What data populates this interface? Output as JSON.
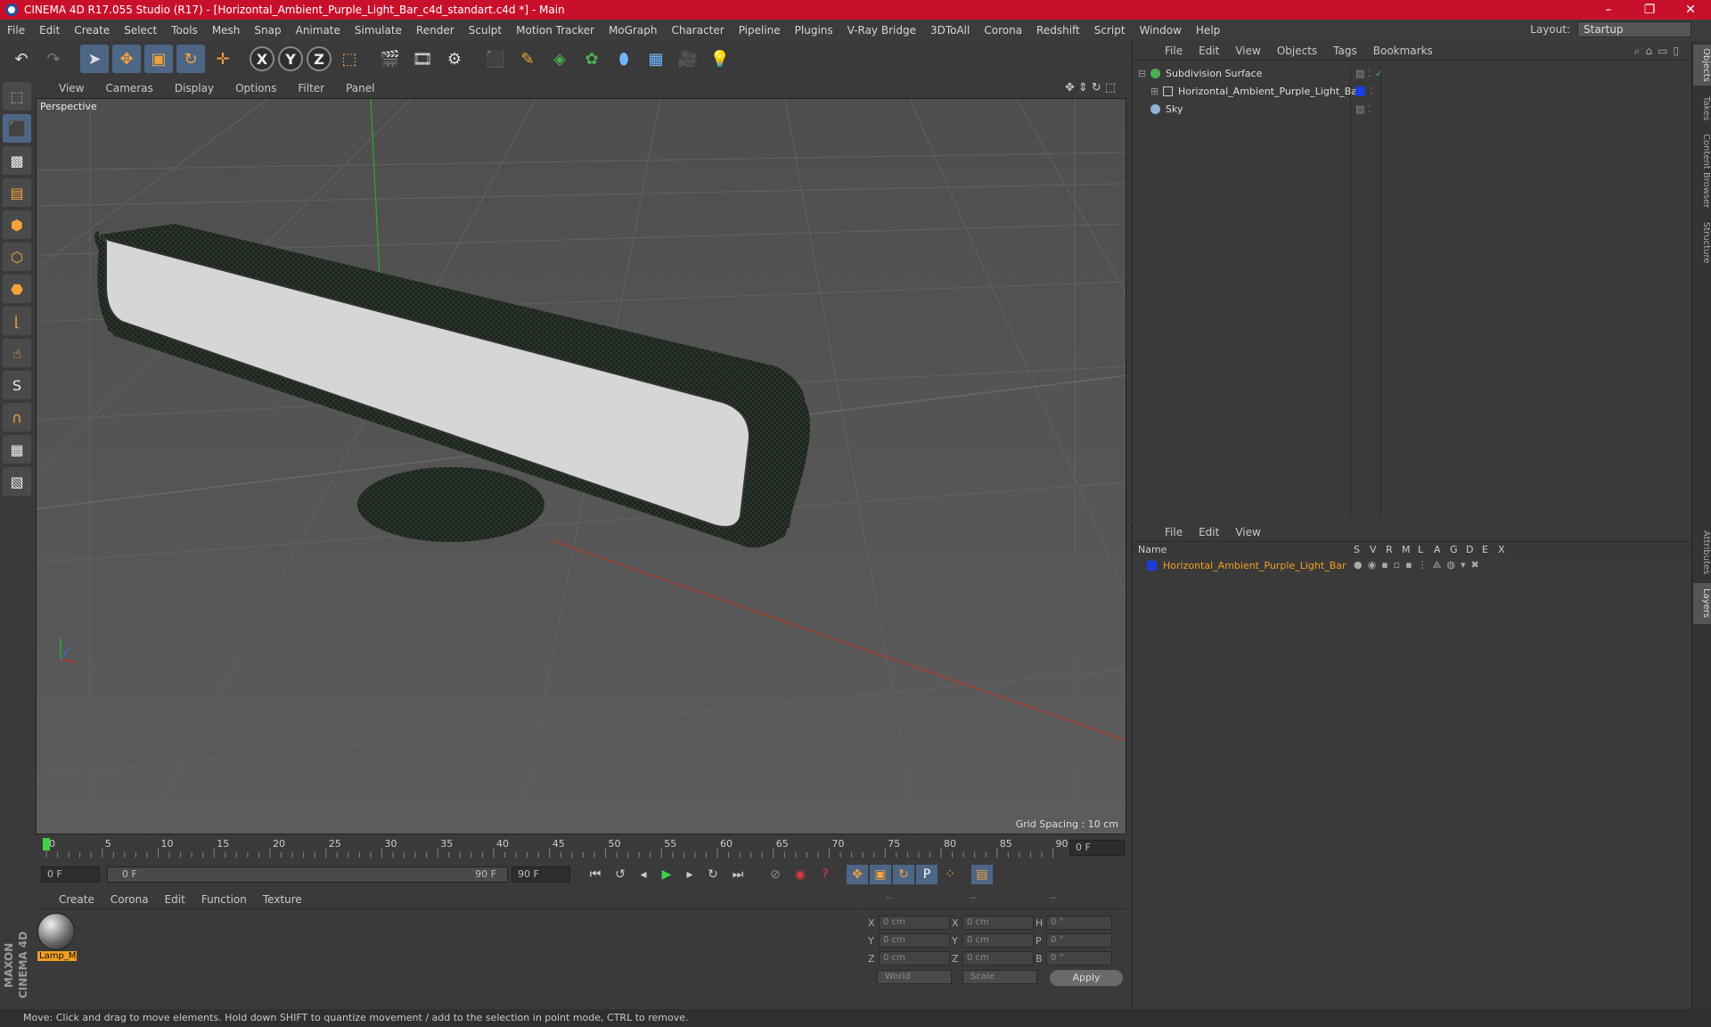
{
  "window": {
    "title": "CINEMA 4D R17.055 Studio (R17) - [Horizontal_Ambient_Purple_Light_Bar_c4d_standart.c4d *] - Main",
    "controls": [
      "–",
      "❐",
      "✕"
    ]
  },
  "menubar": {
    "items": [
      "File",
      "Edit",
      "Create",
      "Select",
      "Tools",
      "Mesh",
      "Snap",
      "Animate",
      "Simulate",
      "Render",
      "Sculpt",
      "Motion Tracker",
      "MoGraph",
      "Character",
      "Pipeline",
      "Plugins",
      "V-Ray Bridge",
      "3DToAll",
      "Corona",
      "Redshift",
      "Script",
      "Window",
      "Help"
    ],
    "layout_label": "Layout:",
    "layout_value": "Startup"
  },
  "toolbar": {
    "undo": "↶",
    "redo": "↷",
    "axis_x": "X",
    "axis_y": "Y",
    "axis_z": "Z"
  },
  "viewport": {
    "menu": [
      "View",
      "Cameras",
      "Display",
      "Options",
      "Filter",
      "Panel"
    ],
    "label": "Perspective",
    "grid_spacing": "Grid Spacing : 10 cm"
  },
  "timeline": {
    "ticks": [
      "0",
      "5",
      "10",
      "15",
      "20",
      "25",
      "30",
      "35",
      "40",
      "45",
      "50",
      "55",
      "60",
      "65",
      "70",
      "75",
      "80",
      "85",
      "90"
    ],
    "current_frame": "0 F",
    "start_field": "0 F",
    "range_start": "0 F",
    "range_end": "90 F",
    "end_field": "90 F"
  },
  "materials": {
    "menu": [
      "Create",
      "Corona",
      "Edit",
      "Function",
      "Texture"
    ],
    "items": [
      {
        "name": "Lamp_M"
      }
    ]
  },
  "coordinates": {
    "headers": [
      "--",
      "--",
      "--"
    ],
    "rows": [
      {
        "l1": "X",
        "v1": "0 cm",
        "l2": "X",
        "v2": "0 cm",
        "l3": "H",
        "v3": "0 °"
      },
      {
        "l1": "Y",
        "v1": "0 cm",
        "l2": "Y",
        "v2": "0 cm",
        "l3": "P",
        "v3": "0 °"
      },
      {
        "l1": "Z",
        "v1": "0 cm",
        "l2": "Z",
        "v2": "0 cm",
        "l3": "B",
        "v3": "0 °"
      }
    ],
    "mode": "World",
    "transform": "Scale",
    "apply": "Apply"
  },
  "objects": {
    "menu": [
      "File",
      "Edit",
      "View",
      "Objects",
      "Tags",
      "Bookmarks"
    ],
    "items": [
      {
        "name": "Subdivision Surface",
        "color": "#4caf50"
      },
      {
        "name": "Horizontal_Ambient_Purple_Light_Bar",
        "color": "#1a3de0"
      },
      {
        "name": "Sky",
        "color": "#8fb3d9"
      }
    ]
  },
  "layers": {
    "menu": [
      "File",
      "Edit",
      "View"
    ],
    "columns": [
      "Name",
      "S",
      "V",
      "R",
      "M",
      "L",
      "A",
      "G",
      "D",
      "E",
      "X"
    ],
    "items": [
      {
        "name": "Horizontal_Ambient_Purple_Light_Bar",
        "color": "#1a3de0"
      }
    ]
  },
  "right_tabs": [
    "Objects",
    "Takes",
    "Content Browser",
    "Structure",
    "Attributes",
    "Layers"
  ],
  "brand": "MAXON CINEMA 4D",
  "status": "Move: Click and drag to move elements. Hold down SHIFT to quantize movement / add to the selection in point mode, CTRL to remove.",
  "colors": {
    "titlebar": "#c9102b",
    "accent": "#f0a020",
    "viewport_bg": "#575757"
  }
}
